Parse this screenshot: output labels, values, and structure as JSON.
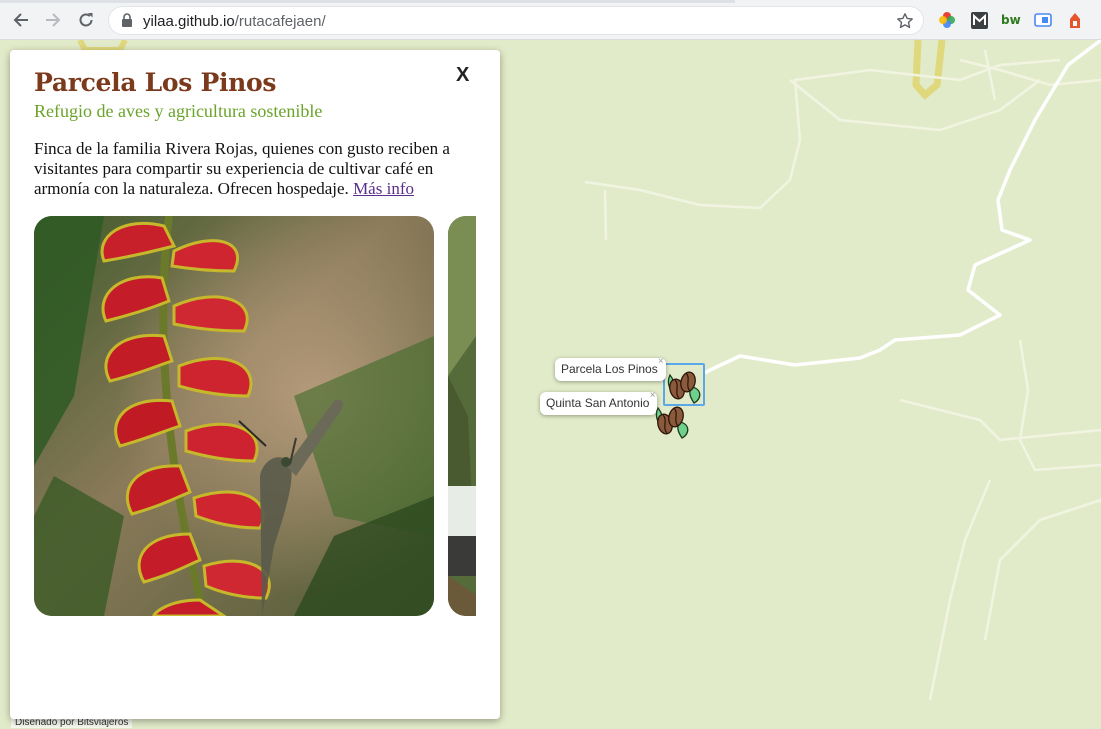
{
  "browser": {
    "url_host": "yilaa.github.io",
    "url_path": "/rutacafejaen/",
    "icons": [
      "back-icon",
      "forward-icon",
      "reload-icon",
      "lock-icon",
      "star-icon",
      "color-wheel-extension-icon",
      "m-extension-icon",
      "bw-extension-icon",
      "blue-extension-icon",
      "orange-extension-icon"
    ]
  },
  "panel": {
    "close_label": "X",
    "title": "Parcela Los Pinos",
    "subtitle": "Refugio de aves y agricultura sostenible",
    "description": "Finca de la familia Rivera Rojas, quienes con gusto reciben a visitantes para compartir su experiencia de cultivar café en armonía con la naturaleza. Ofrecen hospedaje.",
    "more_link": "Más info"
  },
  "map": {
    "markers": [
      {
        "label": "Parcela Los Pinos",
        "close": "×"
      },
      {
        "label": "Quinta San Antonio",
        "close": "×"
      }
    ],
    "credit": "Diseñado por Bitsviajeros"
  },
  "colors": {
    "map_bg": "#e2ebc9",
    "title": "#7a3a1b",
    "subtitle": "#6aa32a",
    "link": "#5a2f8a"
  }
}
